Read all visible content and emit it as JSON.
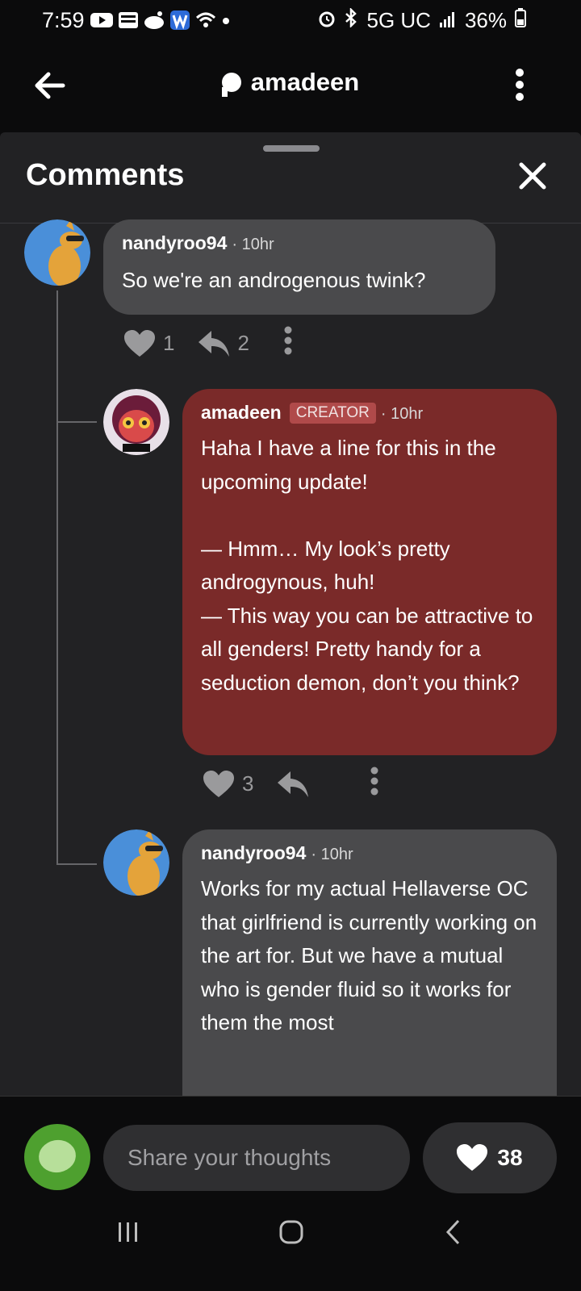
{
  "status_bar": {
    "time": "7:59",
    "network": "5G UC",
    "battery": "36%",
    "left_icons": [
      "youtube-icon",
      "webtoon-icon",
      "reddit-icon",
      "w-app-icon",
      "wifi-icon",
      "dot-icon"
    ],
    "right_icons": [
      "alarm-icon",
      "bluetooth-icon",
      "signal-icon",
      "battery-icon"
    ]
  },
  "app_bar": {
    "title": "amadeen",
    "back_icon": "arrow-left-icon",
    "more_icon": "more-vertical-icon"
  },
  "comments_sheet": {
    "title": "Comments",
    "close_icon": "close-icon",
    "comments": [
      {
        "author": "nandyroo94",
        "time": "· 10hr",
        "text": "So we're an androgenous twink?",
        "likes": "1",
        "replies": "2"
      },
      {
        "author": "amadeen",
        "badge": "CREATOR",
        "time": "· 10hr",
        "text": "Haha I have a line for this in the upcoming update!\n\n— Hmm… My look’s pretty androgynous, huh!\n— This way you can be attractive to all genders! Pretty handy for a seduction demon, don’t you think?",
        "likes": "3",
        "replies": ""
      },
      {
        "author": "nandyroo94",
        "time": "· 10hr",
        "text": "Works for my actual Hellaverse OC that girlfriend is currently working on the art for. But we have a mutual who is gender fluid so it works for them the most"
      }
    ]
  },
  "composer": {
    "placeholder": "Share your thoughts",
    "like_count": "38"
  },
  "colors": {
    "background": "#0b0b0c",
    "sheet": "#222224",
    "bubble_user": "#4a4a4c",
    "bubble_creator": "#7a2a29",
    "badge": "#b04a4a",
    "accent_avatar": "#4ea02f"
  }
}
